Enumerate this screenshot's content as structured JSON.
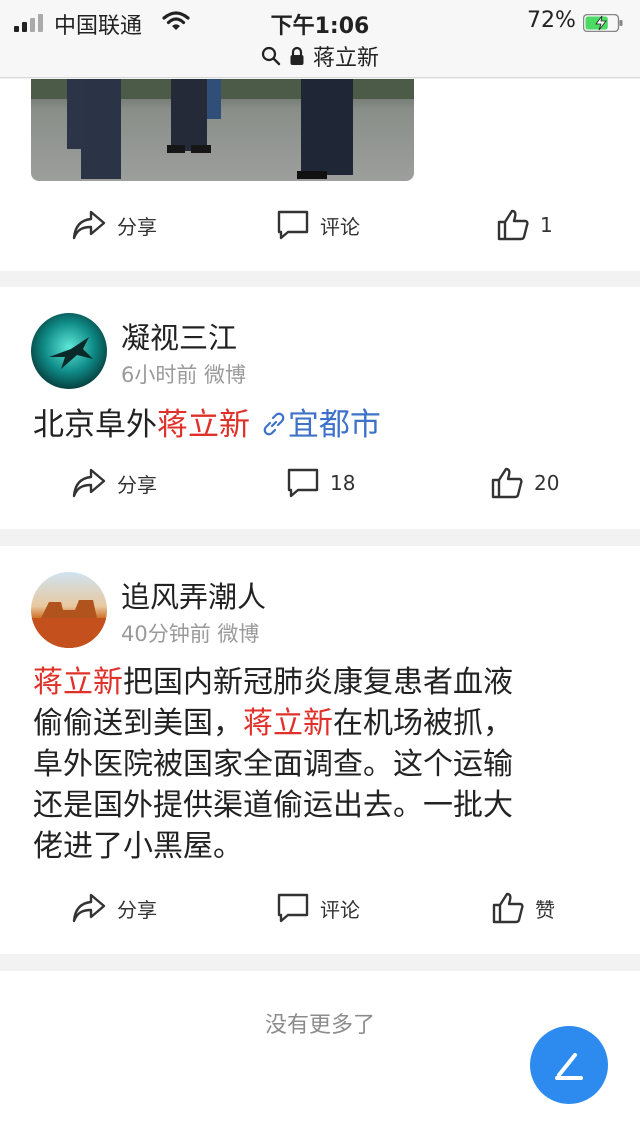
{
  "status_bar": {
    "carrier": "中国联通",
    "time": "下午1:06",
    "battery_percent": "72%",
    "battery_level": 0.72
  },
  "browser": {
    "url_text": "蒋立新"
  },
  "posts": [
    {
      "actions": {
        "share": "分享",
        "comment": "评论",
        "like": "1"
      }
    },
    {
      "username": "凝视三江",
      "meta": "6小时前 微博",
      "text_pre": "北京阜外",
      "text_highlight": "蒋立新",
      "location": "宜都市",
      "actions": {
        "share": "分享",
        "comment": "18",
        "like": "20"
      }
    },
    {
      "username": "追风弄潮人",
      "meta": "40分钟前 微博",
      "text_parts": [
        "蒋立新",
        "把国内新冠肺炎康复患者血液",
        "偷偷送到美国，",
        "蒋立新",
        "在机场被抓，",
        "阜外医院被国家全面调查。这个运输",
        "还是国外提供渠道偷运出去。一批大",
        "佬进了小黑屋。"
      ],
      "actions": {
        "share": "分享",
        "comment": "评论",
        "like": "赞"
      }
    }
  ],
  "footer": {
    "end_text": "没有更多了"
  },
  "colors": {
    "highlight": "#e0302a",
    "link": "#3d72c8",
    "fab": "#2d8bf0"
  },
  "icons": [
    "search-icon",
    "lock-icon",
    "share-icon",
    "comment-icon",
    "like-icon",
    "compose-icon",
    "wifi-icon",
    "battery-icon",
    "signal-icon"
  ]
}
